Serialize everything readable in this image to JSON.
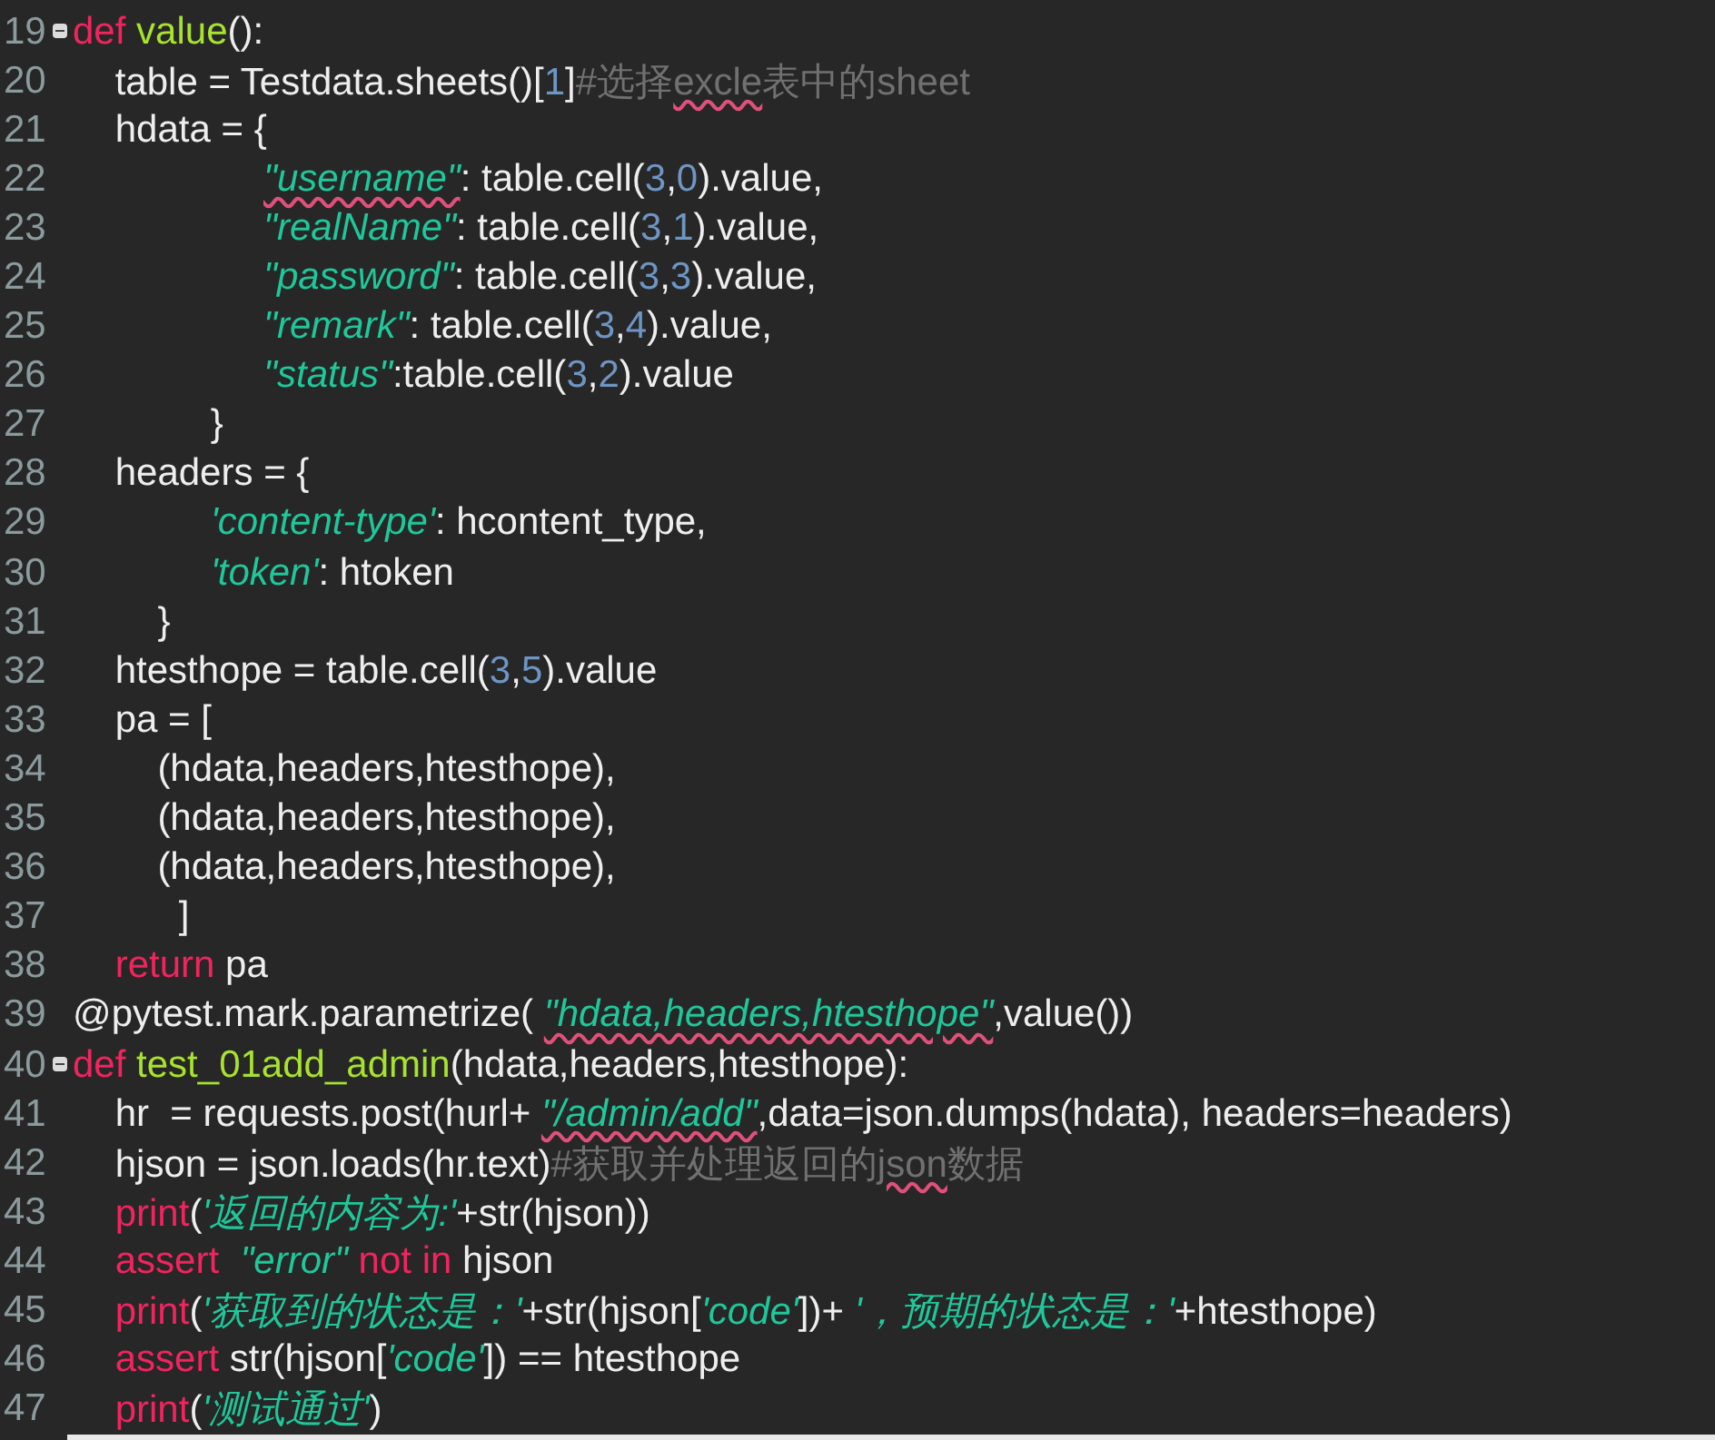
{
  "editor": {
    "lines": [
      {
        "number": "19",
        "fold": true,
        "tokens": [
          {
            "kind": "kw",
            "text": "def",
            "spell": false
          },
          {
            "kind": "fn",
            "text": " value",
            "spell": false
          },
          {
            "kind": "plain",
            "text": "():",
            "spell": false
          }
        ]
      },
      {
        "number": "20",
        "fold": false,
        "tokens": [
          {
            "kind": "plain",
            "text": "    table = Testdata.sheets()[",
            "spell": false
          },
          {
            "kind": "num",
            "text": "1",
            "spell": false
          },
          {
            "kind": "plain",
            "text": "]",
            "spell": false
          },
          {
            "kind": "cm",
            "text": "#选择",
            "spell": false
          },
          {
            "kind": "cm",
            "text": "excle",
            "spell": true
          },
          {
            "kind": "cm",
            "text": "表中的sheet",
            "spell": false
          }
        ]
      },
      {
        "number": "21",
        "fold": false,
        "tokens": [
          {
            "kind": "plain",
            "text": "    hdata = {",
            "spell": false
          }
        ]
      },
      {
        "number": "22",
        "fold": false,
        "tokens": [
          {
            "kind": "str",
            "text": "                  \"username\"",
            "spell": true
          },
          {
            "kind": "plain",
            "text": ": table.cell(",
            "spell": false
          },
          {
            "kind": "num",
            "text": "3",
            "spell": false
          },
          {
            "kind": "plain",
            "text": ",",
            "spell": false
          },
          {
            "kind": "num",
            "text": "0",
            "spell": false
          },
          {
            "kind": "plain",
            "text": ").value,",
            "spell": false
          }
        ]
      },
      {
        "number": "23",
        "fold": false,
        "tokens": [
          {
            "kind": "str",
            "text": "                  \"realName\"",
            "spell": false
          },
          {
            "kind": "plain",
            "text": ": table.cell(",
            "spell": false
          },
          {
            "kind": "num",
            "text": "3",
            "spell": false
          },
          {
            "kind": "plain",
            "text": ",",
            "spell": false
          },
          {
            "kind": "num",
            "text": "1",
            "spell": false
          },
          {
            "kind": "plain",
            "text": ").value,",
            "spell": false
          }
        ]
      },
      {
        "number": "24",
        "fold": false,
        "tokens": [
          {
            "kind": "str",
            "text": "                  \"password\"",
            "spell": false
          },
          {
            "kind": "plain",
            "text": ": table.cell(",
            "spell": false
          },
          {
            "kind": "num",
            "text": "3",
            "spell": false
          },
          {
            "kind": "plain",
            "text": ",",
            "spell": false
          },
          {
            "kind": "num",
            "text": "3",
            "spell": false
          },
          {
            "kind": "plain",
            "text": ").value,",
            "spell": false
          }
        ]
      },
      {
        "number": "25",
        "fold": false,
        "tokens": [
          {
            "kind": "str",
            "text": "                  \"remark\"",
            "spell": false
          },
          {
            "kind": "plain",
            "text": ": table.cell(",
            "spell": false
          },
          {
            "kind": "num",
            "text": "3",
            "spell": false
          },
          {
            "kind": "plain",
            "text": ",",
            "spell": false
          },
          {
            "kind": "num",
            "text": "4",
            "spell": false
          },
          {
            "kind": "plain",
            "text": ").value,",
            "spell": false
          }
        ]
      },
      {
        "number": "26",
        "fold": false,
        "tokens": [
          {
            "kind": "str",
            "text": "                  \"status\"",
            "spell": false
          },
          {
            "kind": "plain",
            "text": ":table.cell(",
            "spell": false
          },
          {
            "kind": "num",
            "text": "3",
            "spell": false
          },
          {
            "kind": "plain",
            "text": ",",
            "spell": false
          },
          {
            "kind": "num",
            "text": "2",
            "spell": false
          },
          {
            "kind": "plain",
            "text": ").value",
            "spell": false
          }
        ]
      },
      {
        "number": "27",
        "fold": false,
        "tokens": [
          {
            "kind": "plain",
            "text": "             }",
            "spell": false
          }
        ]
      },
      {
        "number": "28",
        "fold": false,
        "tokens": [
          {
            "kind": "plain",
            "text": "    headers = {",
            "spell": false
          }
        ]
      },
      {
        "number": "29",
        "fold": false,
        "tokens": [
          {
            "kind": "str",
            "text": "             'content-type'",
            "spell": false
          },
          {
            "kind": "plain",
            "text": ": hcontent_type,",
            "spell": false
          }
        ]
      },
      {
        "number": "30",
        "fold": false,
        "tokens": [
          {
            "kind": "str",
            "text": "             'token'",
            "spell": false
          },
          {
            "kind": "plain",
            "text": ": htoken",
            "spell": false
          }
        ]
      },
      {
        "number": "31",
        "fold": false,
        "tokens": [
          {
            "kind": "plain",
            "text": "        }",
            "spell": false
          }
        ]
      },
      {
        "number": "32",
        "fold": false,
        "tokens": [
          {
            "kind": "plain",
            "text": "    htesthope = table.cell(",
            "spell": false
          },
          {
            "kind": "num",
            "text": "3",
            "spell": false
          },
          {
            "kind": "plain",
            "text": ",",
            "spell": false
          },
          {
            "kind": "num",
            "text": "5",
            "spell": false
          },
          {
            "kind": "plain",
            "text": ").value",
            "spell": false
          }
        ]
      },
      {
        "number": "33",
        "fold": false,
        "tokens": [
          {
            "kind": "plain",
            "text": "    pa = [",
            "spell": false
          }
        ]
      },
      {
        "number": "34",
        "fold": false,
        "tokens": [
          {
            "kind": "plain",
            "text": "        (hdata,headers,htesthope),",
            "spell": false
          }
        ]
      },
      {
        "number": "35",
        "fold": false,
        "tokens": [
          {
            "kind": "plain",
            "text": "        (hdata,headers,htesthope),",
            "spell": false
          }
        ]
      },
      {
        "number": "36",
        "fold": false,
        "tokens": [
          {
            "kind": "plain",
            "text": "        (hdata,headers,htesthope),",
            "spell": false
          }
        ]
      },
      {
        "number": "37",
        "fold": false,
        "tokens": [
          {
            "kind": "plain",
            "text": "          ]",
            "spell": false
          }
        ]
      },
      {
        "number": "38",
        "fold": false,
        "tokens": [
          {
            "kind": "kw",
            "text": "    return",
            "spell": false
          },
          {
            "kind": "plain",
            "text": " pa",
            "spell": false
          }
        ]
      },
      {
        "number": "39",
        "fold": false,
        "tokens": [
          {
            "kind": "plain",
            "text": "@pytest.mark.parametrize( ",
            "spell": false
          },
          {
            "kind": "str",
            "text": "\"hdata,headers,htesthope\"",
            "spell": true
          },
          {
            "kind": "plain",
            "text": ",value())",
            "spell": false
          }
        ]
      },
      {
        "number": "40",
        "fold": true,
        "tokens": [
          {
            "kind": "kw",
            "text": "def",
            "spell": false
          },
          {
            "kind": "fn",
            "text": " test_01add_admin",
            "spell": false
          },
          {
            "kind": "plain",
            "text": "(hdata,headers,htesthope):",
            "spell": false
          }
        ]
      },
      {
        "number": "41",
        "fold": false,
        "tokens": [
          {
            "kind": "plain",
            "text": "    hr  = requests.post(hurl+ ",
            "spell": false
          },
          {
            "kind": "str",
            "text": "\"/admin/add\"",
            "spell": true
          },
          {
            "kind": "plain",
            "text": ",data=json.dumps(hdata), headers=headers)",
            "spell": false
          }
        ]
      },
      {
        "number": "42",
        "fold": false,
        "tokens": [
          {
            "kind": "plain",
            "text": "    hjson = json.loads(hr.text)",
            "spell": false
          },
          {
            "kind": "cm",
            "text": "#获取并处理返回的",
            "spell": false
          },
          {
            "kind": "cm",
            "text": "json",
            "spell": true
          },
          {
            "kind": "cm",
            "text": "数据",
            "spell": false
          }
        ]
      },
      {
        "number": "43",
        "fold": false,
        "tokens": [
          {
            "kind": "kw",
            "text": "    print",
            "spell": false
          },
          {
            "kind": "plain",
            "text": "(",
            "spell": false
          },
          {
            "kind": "str",
            "text": "'返回的内容为:'",
            "spell": false
          },
          {
            "kind": "plain",
            "text": "+str(hjson))",
            "spell": false
          }
        ]
      },
      {
        "number": "44",
        "fold": false,
        "tokens": [
          {
            "kind": "kw",
            "text": "    assert",
            "spell": false
          },
          {
            "kind": "str",
            "text": "  \"error\"",
            "spell": false
          },
          {
            "kind": "kw",
            "text": " not in",
            "spell": false
          },
          {
            "kind": "plain",
            "text": " hjson",
            "spell": false
          }
        ]
      },
      {
        "number": "45",
        "fold": false,
        "tokens": [
          {
            "kind": "kw",
            "text": "    print",
            "spell": false
          },
          {
            "kind": "plain",
            "text": "(",
            "spell": false
          },
          {
            "kind": "str",
            "text": "'获取到的状态是：'",
            "spell": false
          },
          {
            "kind": "plain",
            "text": "+str(hjson[",
            "spell": false
          },
          {
            "kind": "str",
            "text": "'code'",
            "spell": false
          },
          {
            "kind": "plain",
            "text": "])+ ",
            "spell": false
          },
          {
            "kind": "str",
            "text": "'，预期的状态是：'",
            "spell": false
          },
          {
            "kind": "plain",
            "text": "+htesthope)",
            "spell": false
          }
        ]
      },
      {
        "number": "46",
        "fold": false,
        "tokens": [
          {
            "kind": "kw",
            "text": "    assert",
            "spell": false
          },
          {
            "kind": "plain",
            "text": " str(hjson[",
            "spell": false
          },
          {
            "kind": "str",
            "text": "'code'",
            "spell": false
          },
          {
            "kind": "plain",
            "text": "]) == htesthope",
            "spell": false
          }
        ]
      },
      {
        "number": "47",
        "fold": false,
        "tokens": [
          {
            "kind": "kw",
            "text": "    print",
            "spell": false
          },
          {
            "kind": "plain",
            "text": "(",
            "spell": false
          },
          {
            "kind": "str",
            "text": "'测试通过'",
            "spell": false
          },
          {
            "kind": "plain",
            "text": ")",
            "spell": false
          }
        ]
      }
    ]
  }
}
